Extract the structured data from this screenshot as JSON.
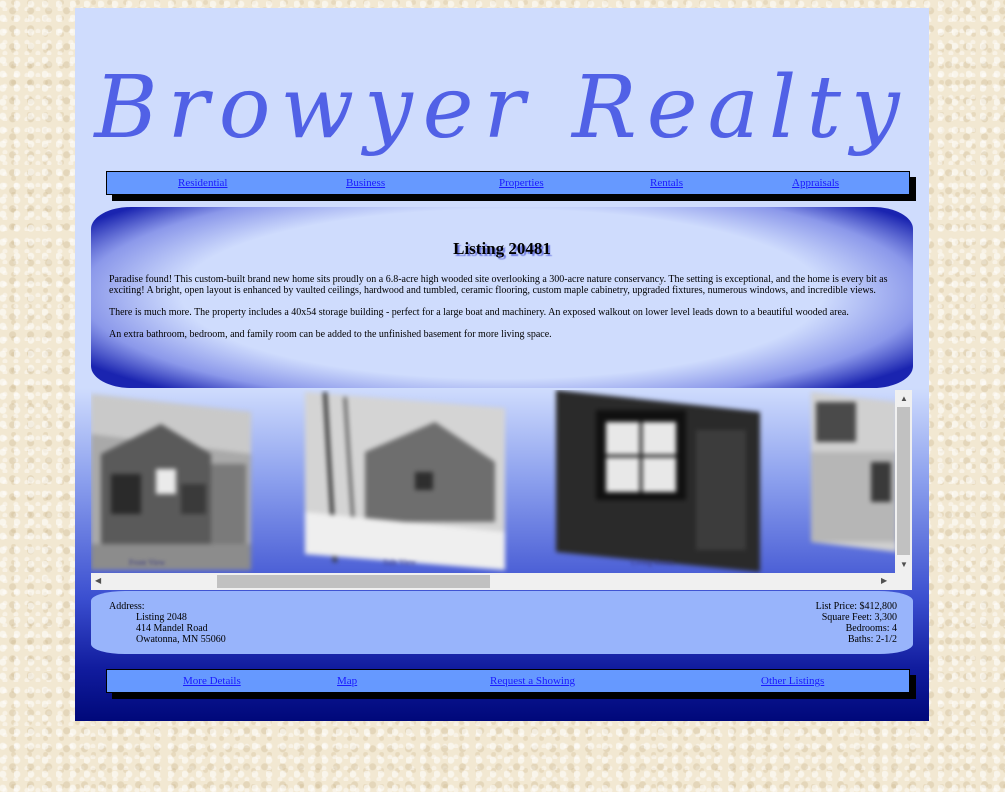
{
  "site": {
    "logo_text": "Browyer Realty"
  },
  "top_nav": [
    "Residential",
    "Business",
    "Properties",
    "Rentals",
    "Appraisals"
  ],
  "listing": {
    "title": "Listing 20481",
    "paragraphs": [
      "Paradise found! This custom-built brand new home sits proudly on a 6.8-acre high wooded site overlooking a 300-acre nature conservancy. The setting is exceptional, and the home is every bit as exciting! A bright, open layout is enhanced by vaulted ceilings, hardwood and tumbled, ceramic flooring, custom maple cabinetry, upgraded fixtures, numerous windows, and incredible views.",
      "There is much more. The property includes a 40x54 storage building - perfect for a large boat and machinery. An exposed walkout on lower level leads down to a beautiful wooded area.",
      "An extra bathroom, bedroom, and family room can be added to the unfinished basement for more living space."
    ]
  },
  "gallery": {
    "captions": [
      "Front View",
      "Side View",
      "Living Room"
    ]
  },
  "details": {
    "address_label": "Address:",
    "address_lines": [
      "Listing 2048",
      "414 Mandel Road",
      "Owatonna, MN 55060"
    ],
    "list_price": "List Price: $412,800",
    "square_feet": "Square Feet: 3,300",
    "bedrooms": "Bedrooms: 4",
    "baths": "Baths: 2-1/2"
  },
  "bottom_nav": [
    "More Details",
    "Map",
    "Request a Showing",
    "Other Listings"
  ]
}
